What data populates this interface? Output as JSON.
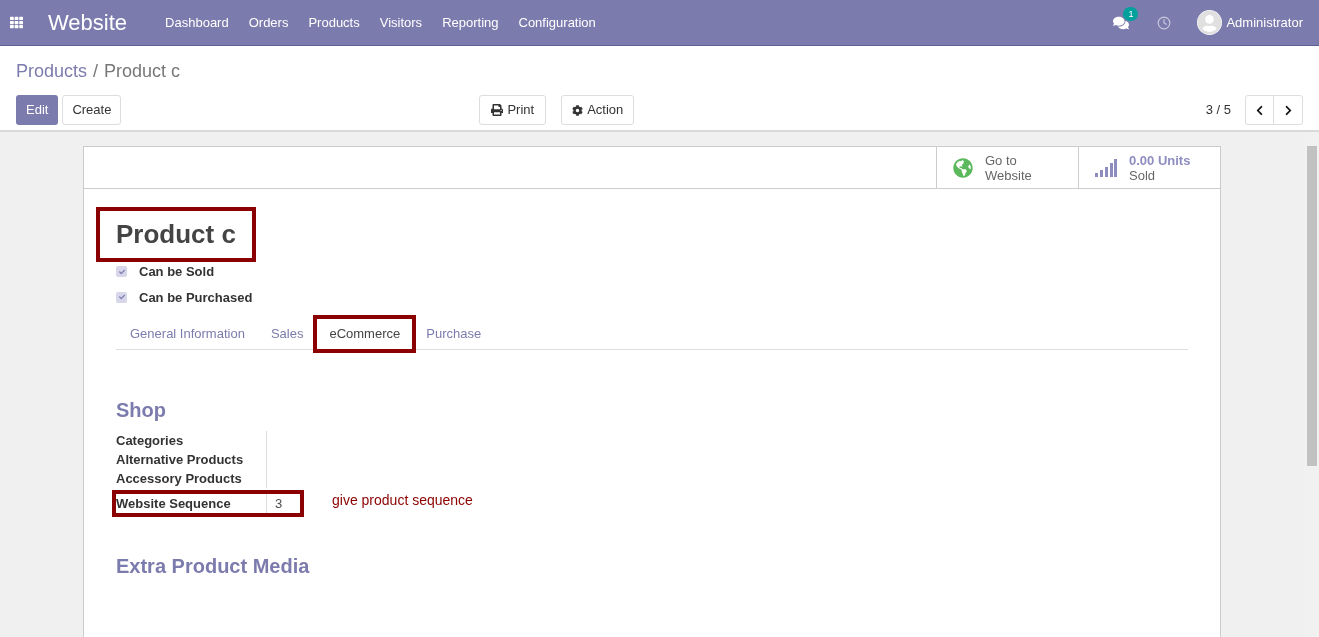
{
  "navbar": {
    "app_title": "Website",
    "menu": [
      "Dashboard",
      "Orders",
      "Products",
      "Visitors",
      "Reporting",
      "Configuration"
    ],
    "message_count": "1",
    "user": "Administrator"
  },
  "breadcrumb": {
    "parent": "Products",
    "separator": "/",
    "current": "Product c"
  },
  "buttons": {
    "edit": "Edit",
    "create": "Create",
    "print": "Print",
    "action": "Action"
  },
  "pager": {
    "counter": "3 / 5"
  },
  "smart_buttons": [
    {
      "kind": "globe",
      "lines": [
        "Go to",
        "Website"
      ]
    },
    {
      "kind": "chart",
      "lines": [
        "0.00 Units",
        "Sold"
      ]
    }
  ],
  "product": {
    "name": "Product c",
    "highlighted": true
  },
  "options": [
    {
      "label": "Can be Sold",
      "checked": true
    },
    {
      "label": "Can be Purchased",
      "checked": true
    }
  ],
  "tabs": [
    {
      "label": "General Information",
      "selected": false,
      "highlighted": false
    },
    {
      "label": "Sales",
      "selected": false,
      "highlighted": false
    },
    {
      "label": "eCommerce",
      "selected": true,
      "highlighted": true
    },
    {
      "label": "Purchase",
      "selected": false,
      "highlighted": false
    }
  ],
  "shop": {
    "title": "Shop",
    "fields": [
      {
        "label": "Categories",
        "highlighted": false
      },
      {
        "label": "Alternative Products",
        "highlighted": false
      },
      {
        "label": "Accessory Products",
        "highlighted": false
      },
      {
        "label": "Website Sequence",
        "value": "3",
        "highlighted": true,
        "note": "give product sequence"
      }
    ]
  },
  "media": {
    "title": "Extra Product Media"
  }
}
